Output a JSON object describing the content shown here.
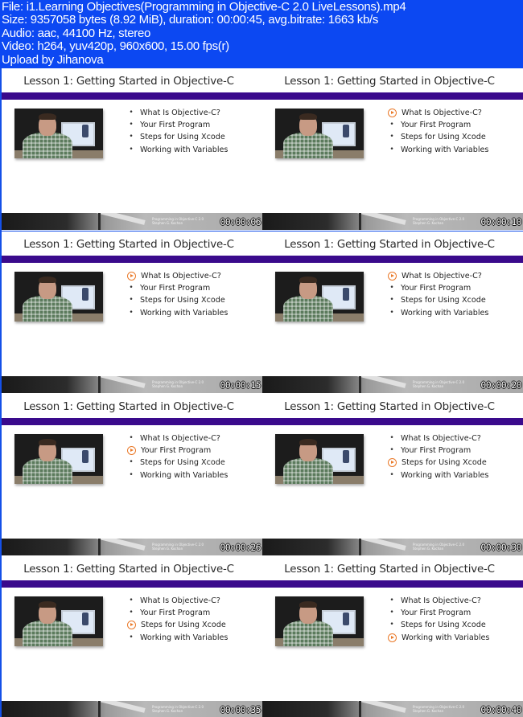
{
  "header": {
    "lines": [
      "File: i1.Learning Objectives(Programming in Objective-C 2.0 LiveLessons).mp4",
      "Size: 9357058 bytes (8.92 MiB), duration: 00:00:45, avg.bitrate: 1663 kb/s",
      "Audio: aac, 44100 Hz, stereo",
      "Video: h264, yuv420p, 960x600, 15.00 fps(r)",
      "Upload by Jihanova"
    ]
  },
  "slide": {
    "title": "Lesson 1: Getting Started in Objective-C",
    "bullets": [
      "What Is Objective-C?",
      "Your First Program",
      "Steps for Using Xcode",
      "Working with Variables"
    ],
    "footer_line1": "Programming in Objective-C 2.0",
    "footer_line2": "Stephen G. Kochan",
    "bullet_glyph": "•",
    "active_marker_icon": "play-circle-icon",
    "accent_color": "#ea7a2a",
    "bar_color": "#3a0a8c"
  },
  "frames": [
    {
      "timestamp": "00:00:06",
      "active_bullet": -1
    },
    {
      "timestamp": "00:00:10",
      "active_bullet": 0
    },
    {
      "timestamp": "00:00:15",
      "active_bullet": 0
    },
    {
      "timestamp": "00:00:20",
      "active_bullet": 0
    },
    {
      "timestamp": "00:00:26",
      "active_bullet": 1
    },
    {
      "timestamp": "00:00:30",
      "active_bullet": 2
    },
    {
      "timestamp": "00:00:35",
      "active_bullet": 2
    },
    {
      "timestamp": "00:00:40",
      "active_bullet": 3
    }
  ]
}
